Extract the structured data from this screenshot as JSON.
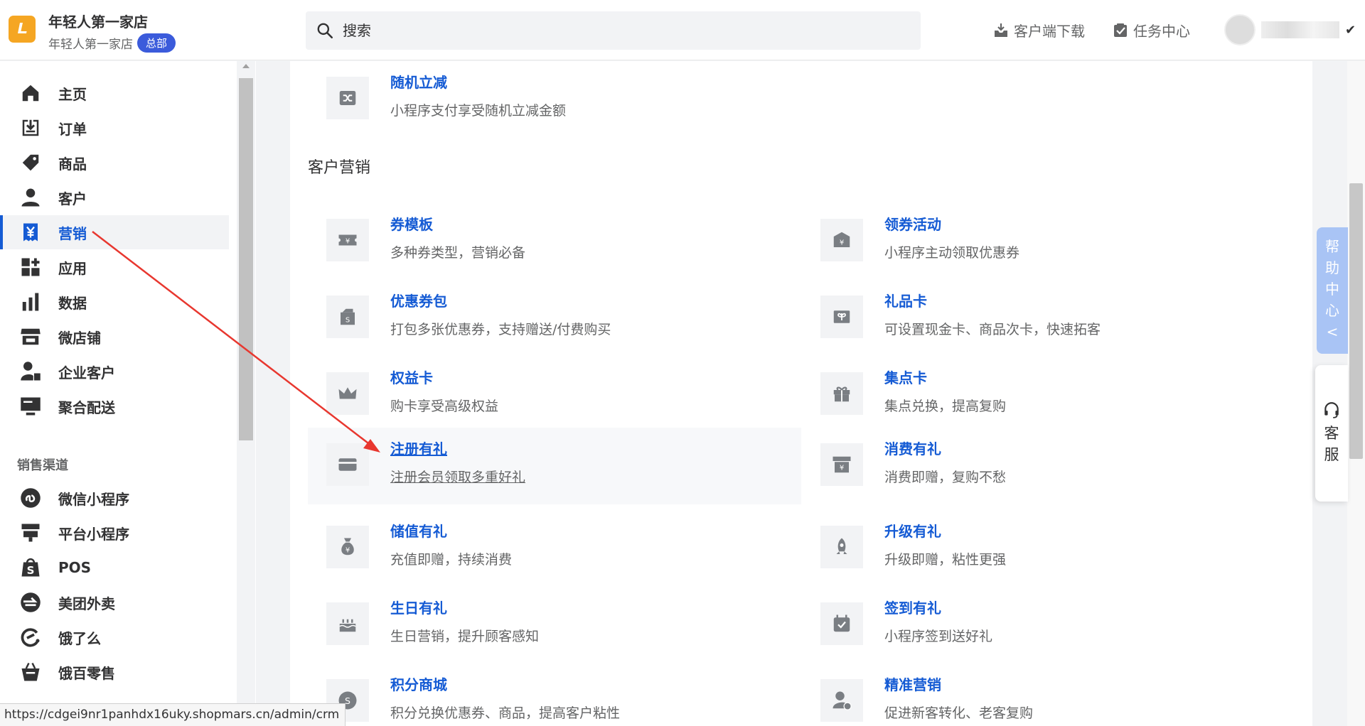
{
  "header": {
    "shop_name": "年轻人第一家店",
    "shop_sub": "年轻人第一家店",
    "badge": "总部",
    "search_placeholder": "搜索",
    "download_label": "客户端下载",
    "tasks_label": "任务中心"
  },
  "sidebar": {
    "items": [
      {
        "label": "主页",
        "icon": "home-icon"
      },
      {
        "label": "订单",
        "icon": "order-icon"
      },
      {
        "label": "商品",
        "icon": "tag-icon"
      },
      {
        "label": "客户",
        "icon": "user-icon"
      },
      {
        "label": "营销",
        "icon": "marketing-icon",
        "active": true
      },
      {
        "label": "应用",
        "icon": "apps-icon"
      },
      {
        "label": "数据",
        "icon": "chart-icon"
      },
      {
        "label": "微店铺",
        "icon": "store-icon"
      },
      {
        "label": "企业客户",
        "icon": "enterprise-user-icon"
      },
      {
        "label": "聚合配送",
        "icon": "delivery-icon"
      }
    ],
    "section_title": "销售渠道",
    "channels": [
      {
        "label": "微信小程序",
        "icon": "wechat-miniapp-icon"
      },
      {
        "label": "平台小程序",
        "icon": "platform-miniapp-icon"
      },
      {
        "label": "POS",
        "icon": "pos-icon"
      },
      {
        "label": "美团外卖",
        "icon": "meituan-icon"
      },
      {
        "label": "饿了么",
        "icon": "eleme-icon"
      },
      {
        "label": "饿百零售",
        "icon": "ebai-retail-icon"
      }
    ]
  },
  "status_url": "https://cdgei9nr1panhdx16uky.shopmars.cn/admin/crm",
  "main": {
    "top_tool": {
      "title": "随机立减",
      "desc": "小程序支付享受随机立减金额",
      "icon": "shuffle-icon"
    },
    "section_title": "客户营销",
    "tools": [
      {
        "title": "券模板",
        "desc": "多种券类型，营销必备",
        "icon": "coupon-icon"
      },
      {
        "title": "领券活动",
        "desc": "小程序主动领取优惠券",
        "icon": "coupon-collect-icon"
      },
      {
        "title": "优惠券包",
        "desc": "打包多张优惠券，支持赠送/付费购买",
        "icon": "coupon-pack-icon"
      },
      {
        "title": "礼品卡",
        "desc": "可设置现金卡、商品次卡，快速拓客",
        "icon": "gift-card-icon"
      },
      {
        "title": "权益卡",
        "desc": "购卡享受高级权益",
        "icon": "crown-icon"
      },
      {
        "title": "集点卡",
        "desc": "集点兑换，提高复购",
        "icon": "gift-box-icon"
      },
      {
        "title": "注册有礼",
        "desc": "注册会员领取多重好礼",
        "icon": "card-icon"
      },
      {
        "title": "消费有礼",
        "desc": "消费即赠，复购不愁",
        "icon": "consume-icon"
      },
      {
        "title": "储值有礼",
        "desc": "充值即赠，持续消费",
        "icon": "money-bag-icon"
      },
      {
        "title": "升级有礼",
        "desc": "升级即赠，粘性更强",
        "icon": "rocket-icon"
      },
      {
        "title": "生日有礼",
        "desc": "生日营销，提升顾客感知",
        "icon": "cake-icon"
      },
      {
        "title": "签到有礼",
        "desc": "小程序签到送好礼",
        "icon": "calendar-check-icon"
      },
      {
        "title": "积分商城",
        "desc": "积分兑换优惠券、商品，提高客户粘性",
        "icon": "points-icon"
      },
      {
        "title": "精准营销",
        "desc": "促进新客转化、老客复购",
        "icon": "target-user-icon"
      }
    ]
  },
  "help_tab": {
    "chars": [
      "帮",
      "助",
      "中",
      "心"
    ],
    "arrow": "<"
  },
  "cs_tab": {
    "chars": [
      "客",
      "服"
    ]
  },
  "colors": {
    "accent": "#155bd4",
    "badge": "#3b5bdb",
    "logo": "#f5a623",
    "arrow": "#e8372f"
  }
}
